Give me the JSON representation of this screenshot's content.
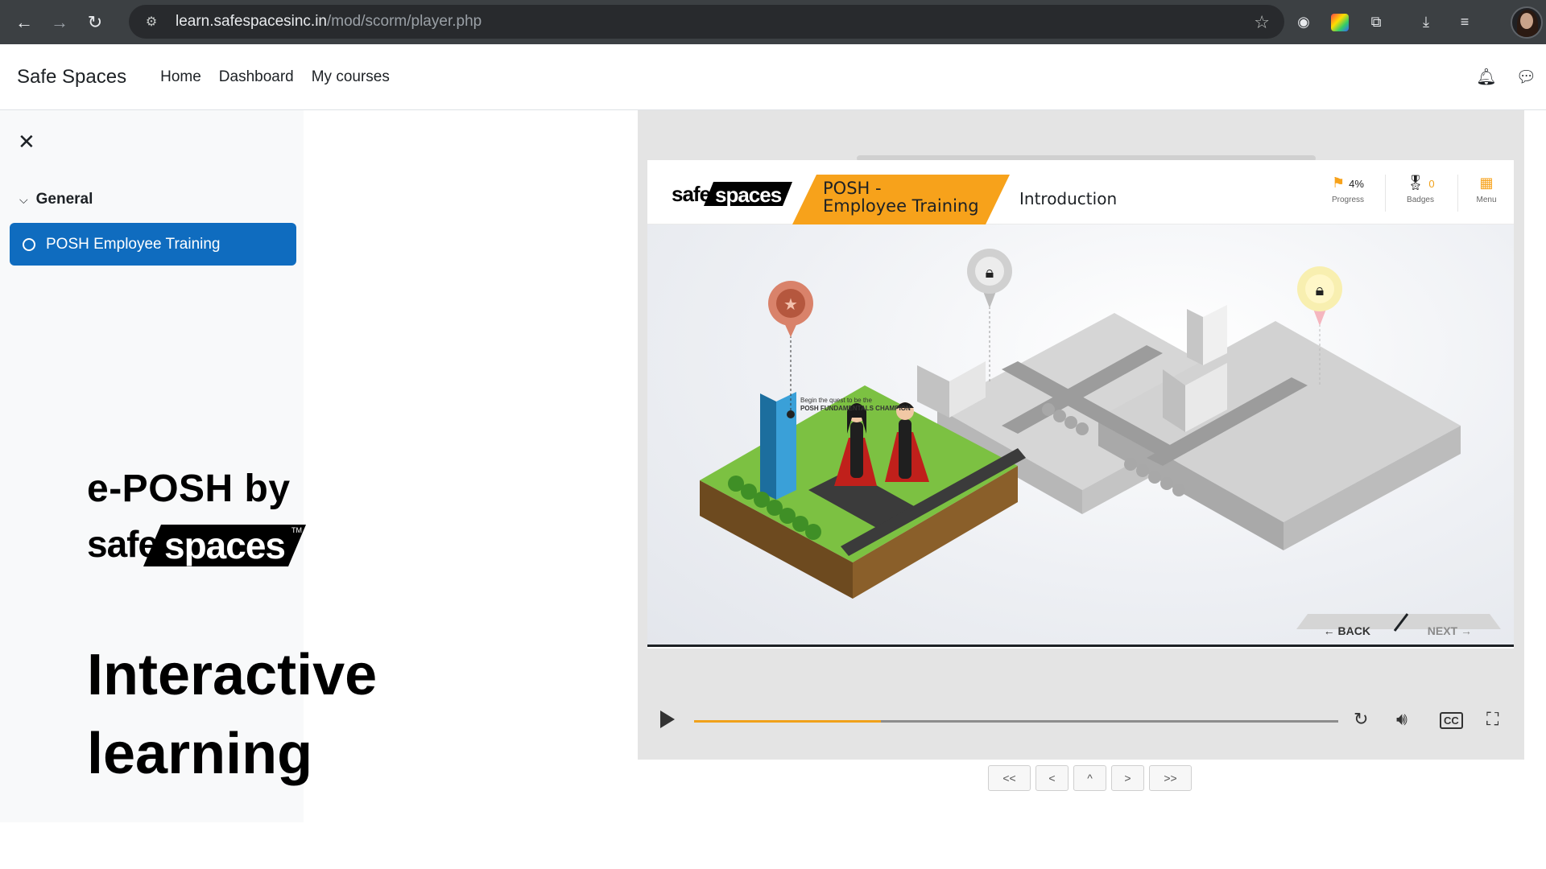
{
  "browser": {
    "url_host": "learn.safespacesinc.in",
    "url_path": "/mod/scorm/player.php"
  },
  "navbar": {
    "brand": "Safe Spaces",
    "links": [
      "Home",
      "Dashboard",
      "My courses"
    ]
  },
  "drawer": {
    "section": "General",
    "activity": "POSH Employee Training"
  },
  "promo": {
    "headline": "e-POSH by",
    "logo_text": "safespaces",
    "tagline_1": "Interactive",
    "tagline_2": "learning"
  },
  "player": {
    "logo_text": "safespaces",
    "course_line1": "POSH -",
    "course_line2": "Employee Training",
    "section_title": "Introduction",
    "progress_value": "4%",
    "progress_label": "Progress",
    "badges_value": "0",
    "badges_label": "Badges",
    "menu_label": "Menu",
    "caption_line1": "Begin the quest to be the",
    "caption_line2": "POSH FUNDAMENTALS CHAMPION",
    "back_label": "← BACK",
    "next_label": "NEXT →",
    "video_progress": 0.29
  },
  "scorm_nav": [
    "<<",
    "<",
    "^",
    ">",
    ">>"
  ],
  "colors": {
    "accent_blue": "#0f6cbf",
    "orange": "#f7a21b",
    "chrome_bg": "#3c4043"
  }
}
